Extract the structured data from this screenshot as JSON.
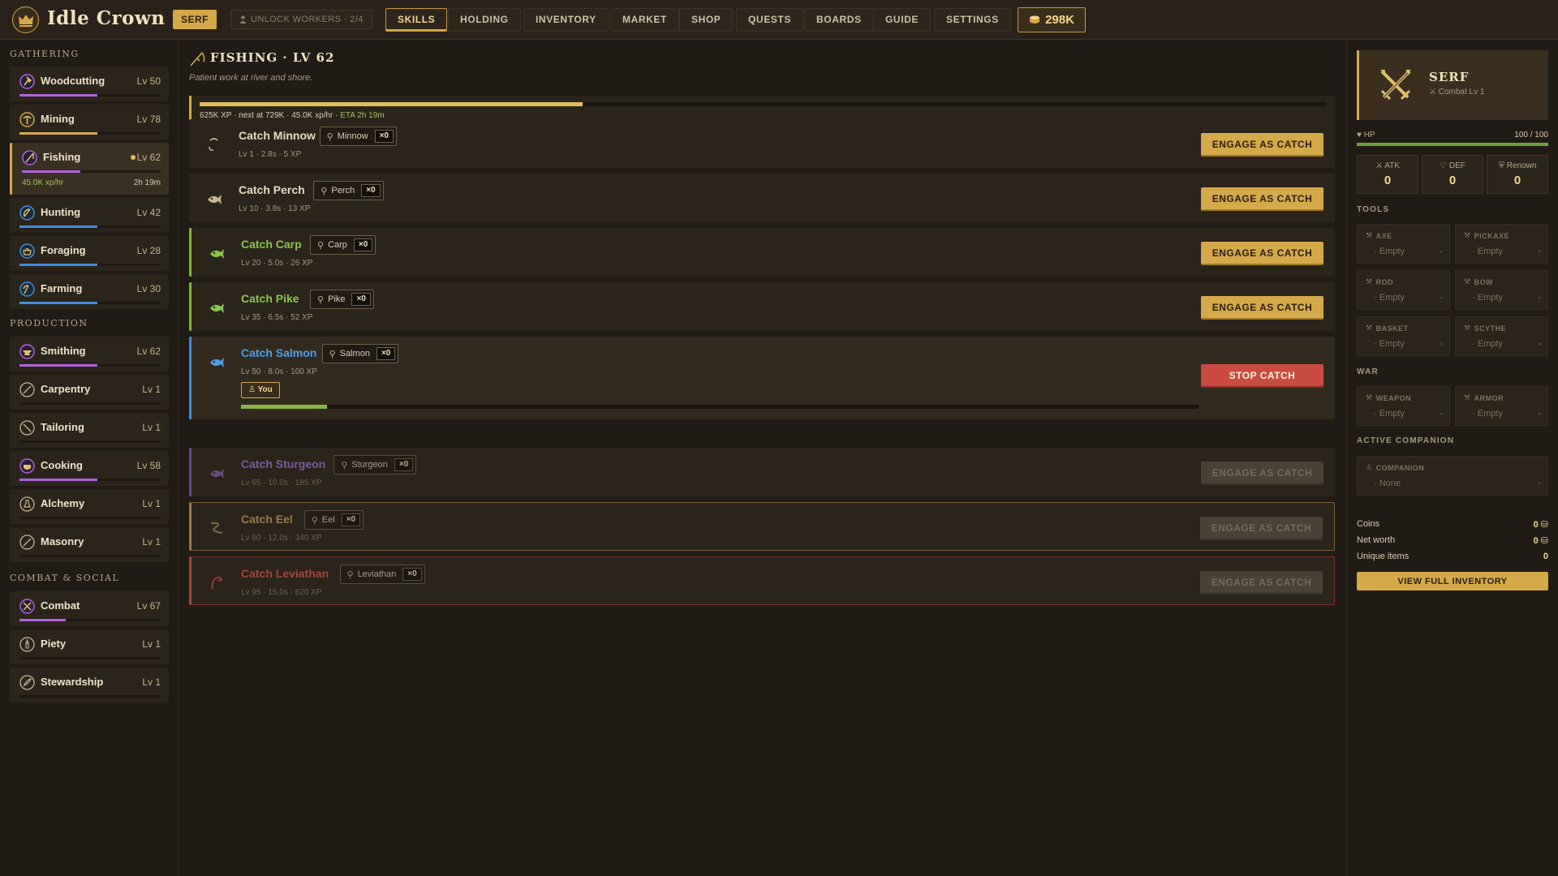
{
  "app": {
    "title": "Idle Crown",
    "rank": "SERF",
    "unlock_workers": "UNLOCK WORKERS · 2/4",
    "coins": "298K"
  },
  "nav": [
    {
      "label": "SKILLS",
      "active": true
    },
    {
      "label": "HOLDING"
    },
    {
      "label": "INVENTORY"
    },
    {
      "label": "MARKET"
    },
    {
      "label": "SHOP"
    },
    {
      "label": "QUESTS"
    },
    {
      "label": "BOARDS"
    },
    {
      "label": "GUIDE"
    },
    {
      "label": "SETTINGS"
    }
  ],
  "sidebar": {
    "gathering_label": "GATHERING",
    "production_label": "PRODUCTION",
    "combat_label": "COMBAT & SOCIAL",
    "gathering": [
      {
        "name": "Woodcutting",
        "lv": "Lv 50",
        "progress": 0.55,
        "color": "#b061e0",
        "icon": "axe-icon"
      },
      {
        "name": "Mining",
        "lv": "Lv 78",
        "progress": 0.55,
        "color": "#d4a94a",
        "icon": "pickaxe-icon"
      },
      {
        "name": "Fishing",
        "lv": "Lv 62",
        "progress": 0.42,
        "color": "#b061e0",
        "icon": "rod-icon",
        "rate": "45.0K xp/hr",
        "eta": "2h 19m"
      },
      {
        "name": "Hunting",
        "lv": "Lv 42",
        "progress": 0.55,
        "color": "#3e8fe0",
        "icon": "bow-icon"
      },
      {
        "name": "Foraging",
        "lv": "Lv 28",
        "progress": 0.55,
        "color": "#3e8fe0",
        "icon": "basket-icon"
      },
      {
        "name": "Farming",
        "lv": "Lv 30",
        "progress": 0.55,
        "color": "#3e8fe0",
        "icon": "scythe-icon"
      }
    ],
    "production": [
      {
        "name": "Smithing",
        "lv": "Lv 62",
        "progress": 0.55,
        "color": "#b061e0",
        "icon": "anvil-icon"
      },
      {
        "name": "Carpentry",
        "lv": "Lv 1",
        "progress": 0,
        "color": "#b061e0",
        "icon": "saw-icon"
      },
      {
        "name": "Tailoring",
        "lv": "Lv 1",
        "progress": 0,
        "color": "#b061e0",
        "icon": "needle-icon"
      },
      {
        "name": "Cooking",
        "lv": "Lv 58",
        "progress": 0.55,
        "color": "#b061e0",
        "icon": "pot-icon"
      },
      {
        "name": "Alchemy",
        "lv": "Lv 1",
        "progress": 0,
        "color": "#b061e0",
        "icon": "flask-icon"
      },
      {
        "name": "Masonry",
        "lv": "Lv 1",
        "progress": 0,
        "color": "#b061e0",
        "icon": "chisel-icon"
      }
    ],
    "combat": [
      {
        "name": "Combat",
        "lv": "Lv 67",
        "progress": 0.33,
        "color": "#b061e0",
        "icon": "swords-icon"
      },
      {
        "name": "Piety",
        "lv": "Lv 1",
        "progress": 0,
        "color": "#b061e0",
        "icon": "candle-icon"
      },
      {
        "name": "Stewardship",
        "lv": "Lv 1",
        "progress": 0,
        "color": "#b061e0",
        "icon": "quill-icon"
      }
    ]
  },
  "main": {
    "title": "FISHING · LV 62",
    "subtitle": "Patient work at river and shore.",
    "xp_progress": 0.34,
    "xp_text": "625K XP · next at 729K · 45.0K xp/hr · ",
    "xp_eta": "ETA 2h 19m",
    "actions": [
      {
        "title": "Catch Minnow",
        "item": "Minnow",
        "qty": "×0",
        "meta": "Lv 1 · 2.8s · 5 XP",
        "button": "ENGAGE AS CATCH",
        "state": "ready",
        "color": "#e6dac0",
        "accent": "",
        "icon": "hook-icon"
      },
      {
        "title": "Catch Perch",
        "item": "Perch",
        "qty": "×0",
        "meta": "Lv 10 · 3.8s · 13 XP",
        "button": "ENGAGE AS CATCH",
        "state": "ready",
        "color": "#e6dac0",
        "accent": "",
        "icon": "fish-icon"
      },
      {
        "title": "Catch Carp",
        "item": "Carp",
        "qty": "×0",
        "meta": "Lv 20 · 5.0s · 26 XP",
        "button": "ENGAGE AS CATCH",
        "state": "ready",
        "color": "#8bc64a",
        "accent": "#7bb83e",
        "icon": "fish-icon"
      },
      {
        "title": "Catch Pike",
        "item": "Pike",
        "qty": "×0",
        "meta": "Lv 35 · 6.5s · 52 XP",
        "button": "ENGAGE AS CATCH",
        "state": "ready",
        "color": "#8bc64a",
        "accent": "#7bb83e",
        "icon": "fish-icon"
      },
      {
        "title": "Catch Salmon",
        "item": "Salmon",
        "qty": "×0",
        "meta": "Lv 50 · 8.0s · 100 XP",
        "button": "STOP CATCH",
        "state": "active",
        "you": "You",
        "progress": 0.09,
        "color": "#4ea0e8",
        "accent": "#3e8fe0",
        "icon": "fish-icon"
      },
      {
        "title": "Catch Sturgeon",
        "item": "Sturgeon",
        "qty": "×0",
        "meta": "Lv 65 · 10.0s · 185 XP",
        "button": "ENGAGE AS CATCH",
        "state": "locked",
        "color": "#7e5aa0",
        "accent": "#6b4a8a",
        "icon": "fish-icon"
      },
      {
        "title": "Catch Eel",
        "item": "Eel",
        "qty": "×0",
        "meta": "Lv 80 · 12.0s · 340 XP",
        "button": "ENGAGE AS CATCH",
        "state": "locked",
        "color": "#9c7a48",
        "accent": "#9c7a48",
        "frame": "#7a5f36",
        "icon": "eel-icon"
      },
      {
        "title": "Catch Leviathan",
        "item": "Leviathan",
        "qty": "×0",
        "meta": "Lv 95 · 15.0s · 620 XP",
        "button": "ENGAGE AS CATCH",
        "state": "locked",
        "color": "#a24a3a",
        "accent": "#a24a3a",
        "frame": "#7e2f24",
        "icon": "serpent-icon"
      }
    ]
  },
  "character": {
    "name": "SERF",
    "sub": "Combat Lv 1",
    "hp_label": "HP",
    "hp_value": "100 / 100",
    "stats": [
      {
        "label": "ATK",
        "value": "0"
      },
      {
        "label": "DEF",
        "value": "0"
      },
      {
        "label": "Renown",
        "value": "0"
      }
    ],
    "tools_label": "TOOLS",
    "tools": [
      {
        "label": "AXE",
        "value": "Empty",
        "dot": "-"
      },
      {
        "label": "PICKAXE",
        "value": "Empty",
        "dot": "-"
      },
      {
        "label": "ROD",
        "value": "Empty",
        "dot": "-"
      },
      {
        "label": "BOW",
        "value": "Empty",
        "dot": "-"
      },
      {
        "label": "BASKET",
        "value": "Empty",
        "dot": "-"
      },
      {
        "label": "SCYTHE",
        "value": "Empty",
        "dot": "-"
      }
    ],
    "war_label": "WAR",
    "war": [
      {
        "label": "WEAPON",
        "value": "Empty",
        "dot": "-"
      },
      {
        "label": "ARMOR",
        "value": "Empty",
        "dot": "-"
      }
    ],
    "companion_label": "ACTIVE COMPANION",
    "companion": {
      "label": "COMPANION",
      "value": "None",
      "dot": "-"
    },
    "summary": [
      {
        "label": "Coins",
        "value": "0"
      },
      {
        "label": "Net worth",
        "value": "0"
      },
      {
        "label": "Unique items",
        "value": "0"
      }
    ],
    "inventory_button": "VIEW FULL INVENTORY"
  }
}
